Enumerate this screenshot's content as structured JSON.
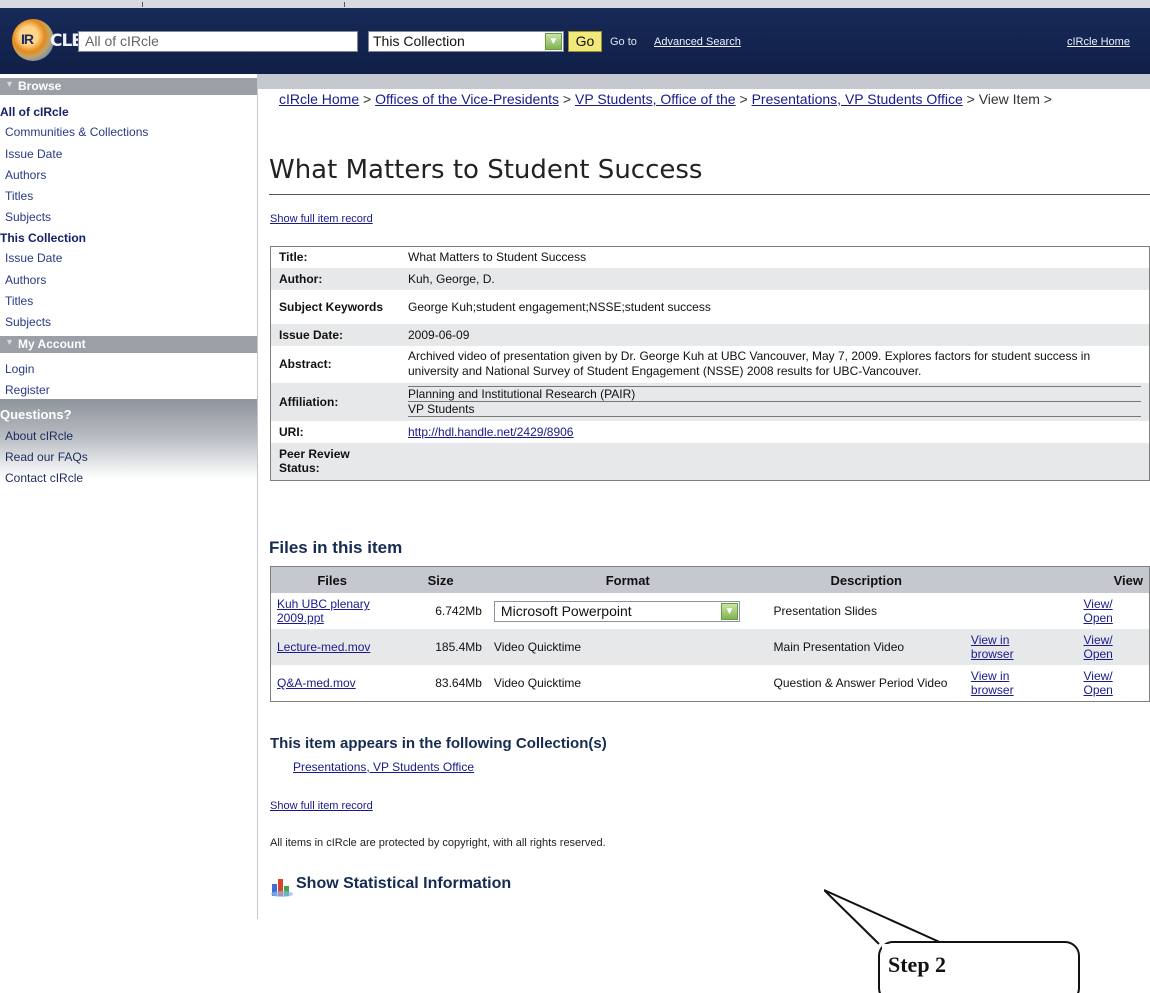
{
  "header": {
    "search_placeholder": "All of cIRcle",
    "scope_selected": "This Collection",
    "go_label": "Go",
    "goto_text": "Go to",
    "advanced_search_label": "Advanced Search",
    "home_label": "cIRcle Home",
    "logo_text_a": "IR",
    "logo_text_b": "CLE"
  },
  "sidebar": {
    "browse_heading": "Browse",
    "all_heading": "All of cIRcle",
    "all_items": [
      "Communities & Collections",
      "Issue Date",
      "Authors",
      "Titles",
      "Subjects"
    ],
    "collection_heading": "This Collection",
    "collection_items": [
      "Issue Date",
      "Authors",
      "Titles",
      "Subjects"
    ],
    "account_heading": "My Account",
    "account_items": [
      "Login",
      "Register"
    ],
    "questions_heading": "Questions?",
    "question_items": [
      "About cIRcle",
      "Read our FAQs",
      "Contact cIRcle"
    ]
  },
  "breadcrumb": {
    "items": [
      "cIRcle Home",
      "Offices of the Vice-Presidents",
      "VP Students, Office of the",
      "Presentations, VP Students Office"
    ],
    "sep": " > ",
    "trail": " > View Item >"
  },
  "item": {
    "title": "What Matters to Student Success",
    "show_full_record": "Show full item record",
    "fields": {
      "title_key": "Title:",
      "title_val": "What Matters to Student Success",
      "author_key": "Author:",
      "author_val": "Kuh, George, D.",
      "subject_key": "Subject Keywords",
      "subject_val": "George Kuh;student engagement;NSSE;student success",
      "issue_key": "Issue Date:",
      "issue_val": "2009-06-09",
      "abstract_key": "Abstract:",
      "abstract_val": "Archived video of presentation given by Dr. George Kuh at UBC Vancouver, May 7, 2009. Explores factors for student success in university and National Survey of Student Engagement (NSSE) 2008 results for UBC-Vancouver.",
      "affiliation_key": "Affiliation:",
      "affiliation_vals": [
        "Planning and Institutional Research (PAIR)",
        "VP Students"
      ],
      "uri_key": "URI:",
      "uri_val": "http://hdl.handle.net/2429/8906",
      "peer_key": "Peer Review Status:",
      "peer_val": ""
    }
  },
  "files": {
    "heading": "Files in this item",
    "columns": [
      "Files",
      "Size",
      "Format",
      "Description",
      "",
      "View"
    ],
    "rows": [
      {
        "name": "Kuh UBC plenary 2009.ppt",
        "size": "6.742Mb",
        "format": "Microsoft Powerpoint",
        "description": "Presentation Slides",
        "browser": "",
        "view": "View/ Open"
      },
      {
        "name": "Lecture-med.mov",
        "size": "185.4Mb",
        "format": "Video Quicktime",
        "description": "Main Presentation Video",
        "browser": "View in browser",
        "view": "View/ Open"
      },
      {
        "name": "Q&A-med.mov",
        "size": "83.64Mb",
        "format": "Video Quicktime",
        "description": "Question & Answer Period Video",
        "browser": "View in browser",
        "view": "View/ Open"
      }
    ]
  },
  "collections": {
    "heading": "This item appears in the following Collection(s)",
    "items": [
      "Presentations, VP Students Office"
    ]
  },
  "footer": {
    "copyright": "All items in cIRcle are protected by copyright, with all rights reserved.",
    "stats_label": "Show Statistical Information"
  },
  "annotation": {
    "callout_text": "Step 2"
  },
  "colors": {
    "header_bg": "#182a58",
    "sidebar_head": "#9aa0a6",
    "link": "#1a1a8c",
    "heading": "#162b52"
  }
}
